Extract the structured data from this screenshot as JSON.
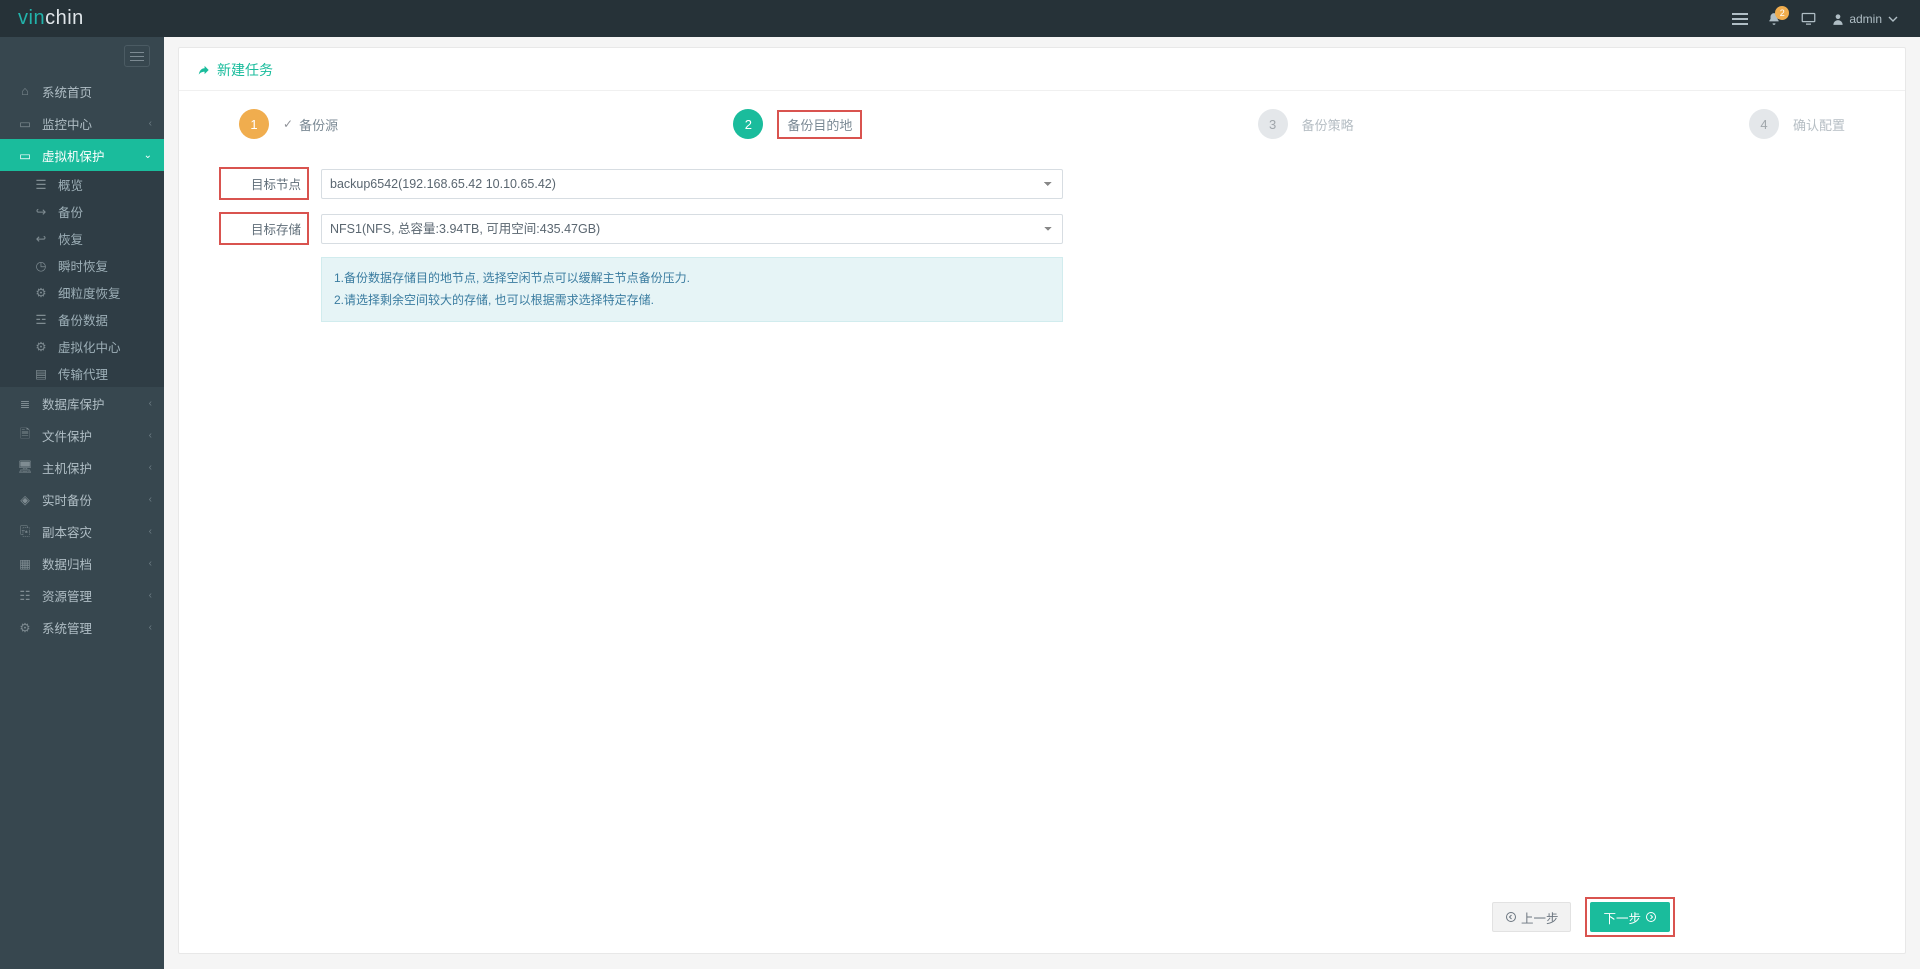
{
  "brand_prefix": "vin",
  "brand_suffix": "chin",
  "header_badge": "2",
  "user_name": "admin",
  "page_title": "新建任务",
  "steps": [
    {
      "num": "1",
      "label": "备份源"
    },
    {
      "num": "2",
      "label": "备份目的地"
    },
    {
      "num": "3",
      "label": "备份策略"
    },
    {
      "num": "4",
      "label": "确认配置"
    }
  ],
  "form": {
    "target_node_label": "目标节点",
    "target_node_value": "backup6542(192.168.65.42 10.10.65.42)",
    "target_storage_label": "目标存储",
    "target_storage_value": "NFS1(NFS, 总容量:3.94TB, 可用空间:435.47GB)",
    "help_line1": "1.备份数据存储目的地节点, 选择空闲节点可以缓解主节点备份压力.",
    "help_line2": "2.请选择剩余空间较大的存储, 也可以根据需求选择特定存储."
  },
  "buttons": {
    "prev": "上一步",
    "next": "下一步"
  },
  "sidebar": {
    "items": [
      {
        "label": "系统首页"
      },
      {
        "label": "监控中心"
      },
      {
        "label": "虚拟机保护"
      },
      {
        "label": "数据库保护"
      },
      {
        "label": "文件保护"
      },
      {
        "label": "主机保护"
      },
      {
        "label": "实时备份"
      },
      {
        "label": "副本容灾"
      },
      {
        "label": "数据归档"
      },
      {
        "label": "资源管理"
      },
      {
        "label": "系统管理"
      }
    ],
    "sub_items": [
      {
        "label": "概览"
      },
      {
        "label": "备份"
      },
      {
        "label": "恢复"
      },
      {
        "label": "瞬时恢复"
      },
      {
        "label": "细粒度恢复"
      },
      {
        "label": "备份数据"
      },
      {
        "label": "虚拟化中心"
      },
      {
        "label": "传输代理"
      }
    ]
  }
}
